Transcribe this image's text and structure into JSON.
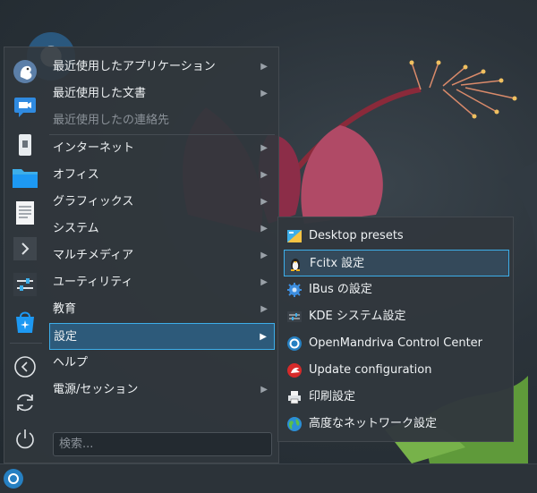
{
  "menu": {
    "categories": [
      {
        "label": "最近使用したアプリケーション",
        "has_submenu": true
      },
      {
        "label": "最近使用した文書",
        "has_submenu": true
      },
      {
        "label": "最近使用したの連絡先",
        "has_submenu": false,
        "disabled": true
      },
      {
        "label": "インターネット",
        "has_submenu": true
      },
      {
        "label": "オフィス",
        "has_submenu": true
      },
      {
        "label": "グラフィックス",
        "has_submenu": true
      },
      {
        "label": "システム",
        "has_submenu": true
      },
      {
        "label": "マルチメディア",
        "has_submenu": true
      },
      {
        "label": "ユーティリティ",
        "has_submenu": true
      },
      {
        "label": "教育",
        "has_submenu": true
      },
      {
        "label": "設定",
        "has_submenu": true,
        "active": true
      },
      {
        "label": "ヘルプ",
        "has_submenu": false
      },
      {
        "label": "電源/セッション",
        "has_submenu": true
      }
    ],
    "search_placeholder": "検索...",
    "favorites": [
      "user-avatar-icon",
      "video-call-icon",
      "usb-drive-icon",
      "folder-icon",
      "text-document-icon",
      "terminal-icon",
      "system-settings-icon",
      "software-store-icon",
      "logout-icon",
      "restart-icon",
      "shutdown-icon"
    ]
  },
  "submenu": {
    "items": [
      {
        "label": "Desktop presets",
        "icon": "desktop-presets-icon"
      },
      {
        "label": "Fcitx 設定",
        "icon": "penguin-keyboard-icon",
        "hover": true
      },
      {
        "label": "IBus の設定",
        "icon": "gear-icon"
      },
      {
        "label": "KDE システム設定",
        "icon": "kde-settings-icon"
      },
      {
        "label": "OpenMandriva Control Center",
        "icon": "openmandriva-icon"
      },
      {
        "label": "Update configuration",
        "icon": "update-config-icon"
      },
      {
        "label": "印刷設定",
        "icon": "printer-icon"
      },
      {
        "label": "高度なネットワーク設定",
        "icon": "network-globe-icon"
      }
    ]
  },
  "colors": {
    "accent": "#3daee9",
    "menu_bg": "#31373d",
    "active_bg": "#2d5a7a"
  }
}
